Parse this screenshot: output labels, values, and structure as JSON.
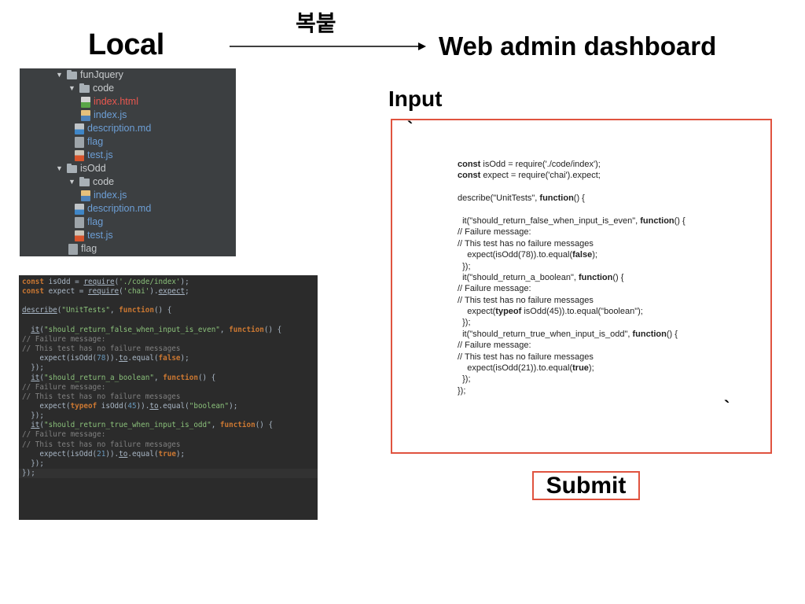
{
  "headings": {
    "local": "Local",
    "copy_paste": "복붙",
    "web_admin": "Web admin dashboard",
    "input": "Input"
  },
  "file_tree": [
    {
      "indent": 0,
      "arrow": "▼",
      "icon": "folder-icon",
      "label": "funJquery",
      "color": "folder"
    },
    {
      "indent": 1,
      "arrow": "▼",
      "icon": "folder-icon",
      "label": "code",
      "color": "folder"
    },
    {
      "indent": 2,
      "arrow": "",
      "icon": "html-file-icon",
      "label": "index.html",
      "color": "red"
    },
    {
      "indent": 2,
      "arrow": "",
      "icon": "js-file-icon",
      "label": "index.js",
      "color": "blue"
    },
    {
      "indent": 1.5,
      "arrow": "",
      "icon": "markdown-file-icon",
      "label": "description.md",
      "color": "blue"
    },
    {
      "indent": 1.5,
      "arrow": "",
      "icon": "flag-file-icon",
      "label": "flag",
      "color": "blue"
    },
    {
      "indent": 1.5,
      "arrow": "",
      "icon": "test-file-icon",
      "label": "test.js",
      "color": "blue"
    },
    {
      "indent": 0,
      "arrow": "▼",
      "icon": "folder-icon",
      "label": "isOdd",
      "color": "folder"
    },
    {
      "indent": 1,
      "arrow": "▼",
      "icon": "folder-icon",
      "label": "code",
      "color": "folder"
    },
    {
      "indent": 2,
      "arrow": "",
      "icon": "js-file-icon",
      "label": "index.js",
      "color": "blue"
    },
    {
      "indent": 1.5,
      "arrow": "",
      "icon": "markdown-file-icon",
      "label": "description.md",
      "color": "blue"
    },
    {
      "indent": 1.5,
      "arrow": "",
      "icon": "flag-file-icon",
      "label": "flag",
      "color": "blue"
    },
    {
      "indent": 1.5,
      "arrow": "",
      "icon": "test-file-icon",
      "label": "test.js",
      "color": "blue"
    },
    {
      "indent": 1,
      "arrow": "",
      "icon": "flag-file-icon",
      "label": "flag",
      "color": "gray"
    }
  ],
  "local_code": [
    [
      [
        "kw",
        "const "
      ],
      [
        "",
        "isOdd = "
      ],
      [
        "ul",
        "require"
      ],
      [
        "",
        "("
      ],
      [
        "str",
        "'./code/index'"
      ],
      [
        "",
        ");"
      ]
    ],
    [
      [
        "kw",
        "const "
      ],
      [
        "",
        "expect = "
      ],
      [
        "ul",
        "require"
      ],
      [
        "",
        "("
      ],
      [
        "str",
        "'chai'"
      ],
      [
        "",
        ")."
      ],
      [
        "ul",
        "expect"
      ],
      [
        "",
        ";"
      ]
    ],
    [],
    [
      [
        "ul",
        "describe"
      ],
      [
        "",
        "("
      ],
      [
        "str",
        "\"UnitTests\""
      ],
      [
        "",
        ", "
      ],
      [
        "kw",
        "function"
      ],
      [
        "",
        "() {"
      ]
    ],
    [],
    [
      [
        "",
        "  "
      ],
      [
        "ul",
        "it"
      ],
      [
        "",
        "("
      ],
      [
        "str",
        "\"should_return_false_when_input_is_even\""
      ],
      [
        "",
        ", "
      ],
      [
        "kw",
        "function"
      ],
      [
        "",
        "() {"
      ]
    ],
    [
      [
        "cm",
        "// Failure message:"
      ]
    ],
    [
      [
        "cm",
        "// This test has no failure messages"
      ]
    ],
    [
      [
        "",
        "    expect(isOdd("
      ],
      [
        "num",
        "78"
      ],
      [
        "",
        "))."
      ],
      [
        "ul",
        "to"
      ],
      [
        "",
        ".equal("
      ],
      [
        "kw",
        "false"
      ],
      [
        "",
        ");"
      ]
    ],
    [
      [
        "",
        "  });"
      ]
    ],
    [
      [
        "",
        "  "
      ],
      [
        "ul",
        "it"
      ],
      [
        "",
        "("
      ],
      [
        "str",
        "\"should_return_a_boolean\""
      ],
      [
        "",
        ", "
      ],
      [
        "kw",
        "function"
      ],
      [
        "",
        "() {"
      ]
    ],
    [
      [
        "cm",
        "// Failure message:"
      ]
    ],
    [
      [
        "cm",
        "// This test has no failure messages"
      ]
    ],
    [
      [
        "",
        "    expect("
      ],
      [
        "kw",
        "typeof "
      ],
      [
        "",
        "isOdd("
      ],
      [
        "num",
        "45"
      ],
      [
        "",
        "))."
      ],
      [
        "ul",
        "to"
      ],
      [
        "",
        ".equal("
      ],
      [
        "str",
        "\"boolean\""
      ],
      [
        "",
        ");"
      ]
    ],
    [
      [
        "",
        "  });"
      ]
    ],
    [
      [
        "",
        "  "
      ],
      [
        "ul",
        "it"
      ],
      [
        "",
        "("
      ],
      [
        "str",
        "\"should_return_true_when_input_is_odd\""
      ],
      [
        "",
        ", "
      ],
      [
        "kw",
        "function"
      ],
      [
        "",
        "() {"
      ]
    ],
    [
      [
        "cm",
        "// Failure message:"
      ]
    ],
    [
      [
        "cm",
        "// This test has no failure messages"
      ]
    ],
    [
      [
        "",
        "    expect(isOdd("
      ],
      [
        "num",
        "21"
      ],
      [
        "",
        "))."
      ],
      [
        "ul",
        "to"
      ],
      [
        "",
        ".equal("
      ],
      [
        "kw",
        "true"
      ],
      [
        "",
        ");"
      ]
    ],
    [
      [
        "",
        "  });"
      ]
    ],
    [
      [
        "",
        "});"
      ]
    ]
  ],
  "input_box": {
    "tick_top": "`",
    "tick_bottom": "`",
    "code": [
      [
        [
          "b",
          "const"
        ],
        [
          "",
          " isOdd = require('./code/index');"
        ]
      ],
      [
        [
          "b",
          "const"
        ],
        [
          "",
          " expect = require('chai').expect;"
        ]
      ],
      [],
      [
        [
          "",
          "describe(\"UnitTests\", "
        ],
        [
          "b",
          "function"
        ],
        [
          "",
          "() {"
        ]
      ],
      [],
      [
        [
          "",
          "  it(\"should_return_false_when_input_is_even\", "
        ],
        [
          "b",
          "function"
        ],
        [
          "",
          "() {"
        ]
      ],
      [
        [
          "",
          "// Failure message:"
        ]
      ],
      [
        [
          "",
          "// This test has no failure messages"
        ]
      ],
      [
        [
          "",
          "    expect(isOdd(78)).to.equal("
        ],
        [
          "b",
          "false"
        ],
        [
          "",
          ");"
        ]
      ],
      [
        [
          "",
          "  });"
        ]
      ],
      [
        [
          "",
          "  it(\"should_return_a_boolean\", "
        ],
        [
          "b",
          "function"
        ],
        [
          "",
          "() {"
        ]
      ],
      [
        [
          "",
          "// Failure message:"
        ]
      ],
      [
        [
          "",
          "// This test has no failure messages"
        ]
      ],
      [
        [
          "",
          "    expect("
        ],
        [
          "b",
          "typeof"
        ],
        [
          "",
          " isOdd(45)).to.equal(\"boolean\");"
        ]
      ],
      [
        [
          "",
          "  });"
        ]
      ],
      [
        [
          "",
          "  it(\"should_return_true_when_input_is_odd\", "
        ],
        [
          "b",
          "function"
        ],
        [
          "",
          "() {"
        ]
      ],
      [
        [
          "",
          "// Failure message:"
        ]
      ],
      [
        [
          "",
          "// This test has no failure messages"
        ]
      ],
      [
        [
          "",
          "    expect(isOdd(21)).to.equal("
        ],
        [
          "b",
          "true"
        ],
        [
          "",
          ");"
        ]
      ],
      [
        [
          "",
          "  });"
        ]
      ],
      [
        [
          "",
          "});"
        ]
      ]
    ]
  },
  "submit_label": "Submit",
  "colors": {
    "accent_border": "#e0533f",
    "tree_bg": "#3c3f41",
    "code_bg": "#2b2b2b"
  }
}
